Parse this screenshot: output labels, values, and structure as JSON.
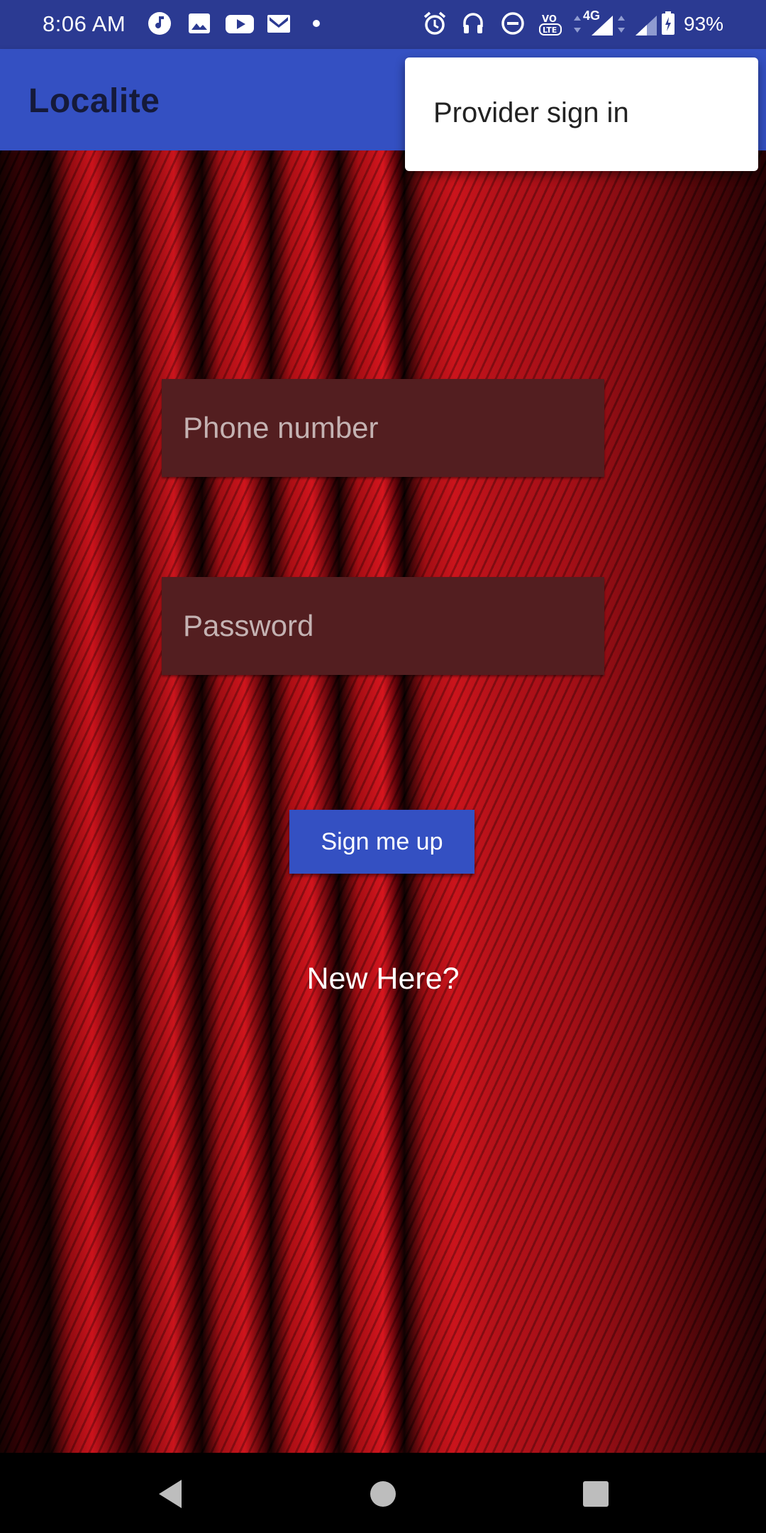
{
  "status_bar": {
    "time": "8:06 AM",
    "network": "4G",
    "battery": "93%",
    "icons": [
      "music-note-icon",
      "image-icon",
      "youtube-icon",
      "gmail-icon",
      "dot-icon",
      "alarm-icon",
      "headset-icon",
      "dnd-icon",
      "volte-icon",
      "signal-icon",
      "signal-icon-2",
      "battery-icon"
    ]
  },
  "app_bar": {
    "title": "Localite"
  },
  "menu": {
    "provider_sign_in": "Provider sign in"
  },
  "form": {
    "phone_placeholder": "Phone number",
    "password_placeholder": "Password",
    "signup_label": "Sign me up",
    "new_here": "New Here?"
  },
  "colors": {
    "status_bar": "#2b3a92",
    "app_bar": "#3450c2",
    "field_bg": "#531e20",
    "button": "#3450c2"
  },
  "nav_bar": {
    "buttons": [
      "back-icon",
      "home-icon",
      "recents-icon"
    ]
  }
}
